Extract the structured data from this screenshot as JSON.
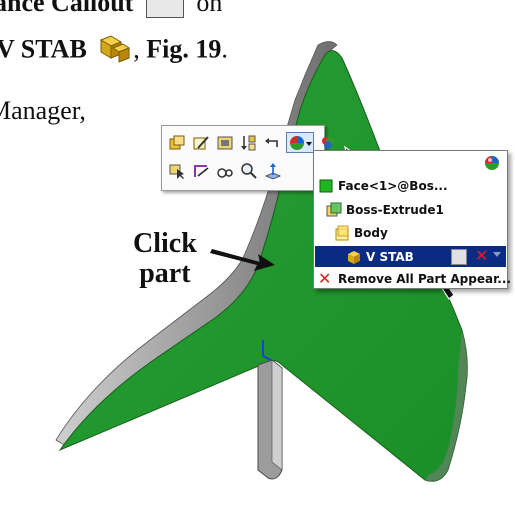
{
  "book_text": {
    "line1_label": "ance Callout",
    "line1_suffix": "on",
    "line2_name": "V STAB",
    "line2_sep": ",",
    "line2_fig": "Fig. 19",
    "line2_end": ".",
    "line3": "Manager,"
  },
  "callout_labels": {
    "click": "Click",
    "part": "part"
  },
  "toolbar": {
    "row1": [
      "appearance-icon",
      "edit-appearance-icon",
      "texture-icon",
      "display-state-icon",
      "undo-icon",
      "appearance-callout-icon",
      "color-swatch-icon"
    ],
    "row2": [
      "select-icon",
      "sketch-icon",
      "view-orientation-icon",
      "zoom-to-selection-icon",
      "normal-to-icon"
    ]
  },
  "appearance_menu": {
    "items": [
      {
        "label": "Face<1>@Bos...",
        "icon": "face-icon"
      },
      {
        "label": "Boss-Extrude1",
        "icon": "feature-icon"
      },
      {
        "label": "Body",
        "icon": "body-icon"
      },
      {
        "label": "V STAB",
        "icon": "part-icon",
        "selected": true
      },
      {
        "label": "Remove All Part Appear...",
        "icon": "remove-icon"
      }
    ]
  },
  "colors": {
    "part_green": "#1f9a2a",
    "edge_gray": "#a9a9a9",
    "selection_blue": "#0a2a84"
  }
}
